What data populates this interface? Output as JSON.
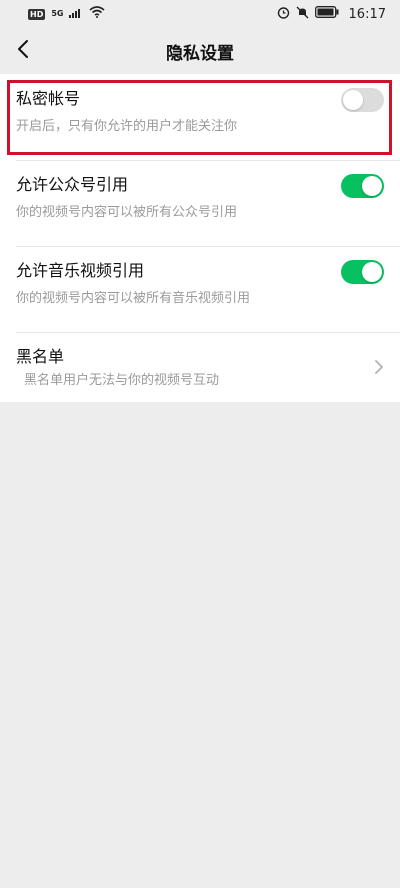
{
  "status_bar": {
    "hd_badge": "HD",
    "network_type": "5G",
    "time": "16:17"
  },
  "nav": {
    "title": "隐私设置"
  },
  "settings": [
    {
      "title": "私密帐号",
      "description": "开启后，只有你允许的用户才能关注你",
      "control": "toggle",
      "enabled": false
    },
    {
      "title": "允许公众号引用",
      "description": "你的视频号内容可以被所有公众号引用",
      "control": "toggle",
      "enabled": true
    },
    {
      "title": "允许音乐视频引用",
      "description": "你的视频号内容可以被所有音乐视频引用",
      "control": "toggle",
      "enabled": true
    },
    {
      "title": "黑名单",
      "description": "黑名单用户无法与你的视频号互动",
      "control": "chevron"
    }
  ],
  "colors": {
    "toggle_on": "#07c160",
    "toggle_off": "#dcdcdc",
    "highlight": "#d0112b",
    "background": "#ededed"
  },
  "icons": [
    "back-arrow-icon",
    "signal-icon",
    "wifi-icon",
    "alarm-icon",
    "mute-bell-icon",
    "battery-icon",
    "chevron-right-icon"
  ]
}
